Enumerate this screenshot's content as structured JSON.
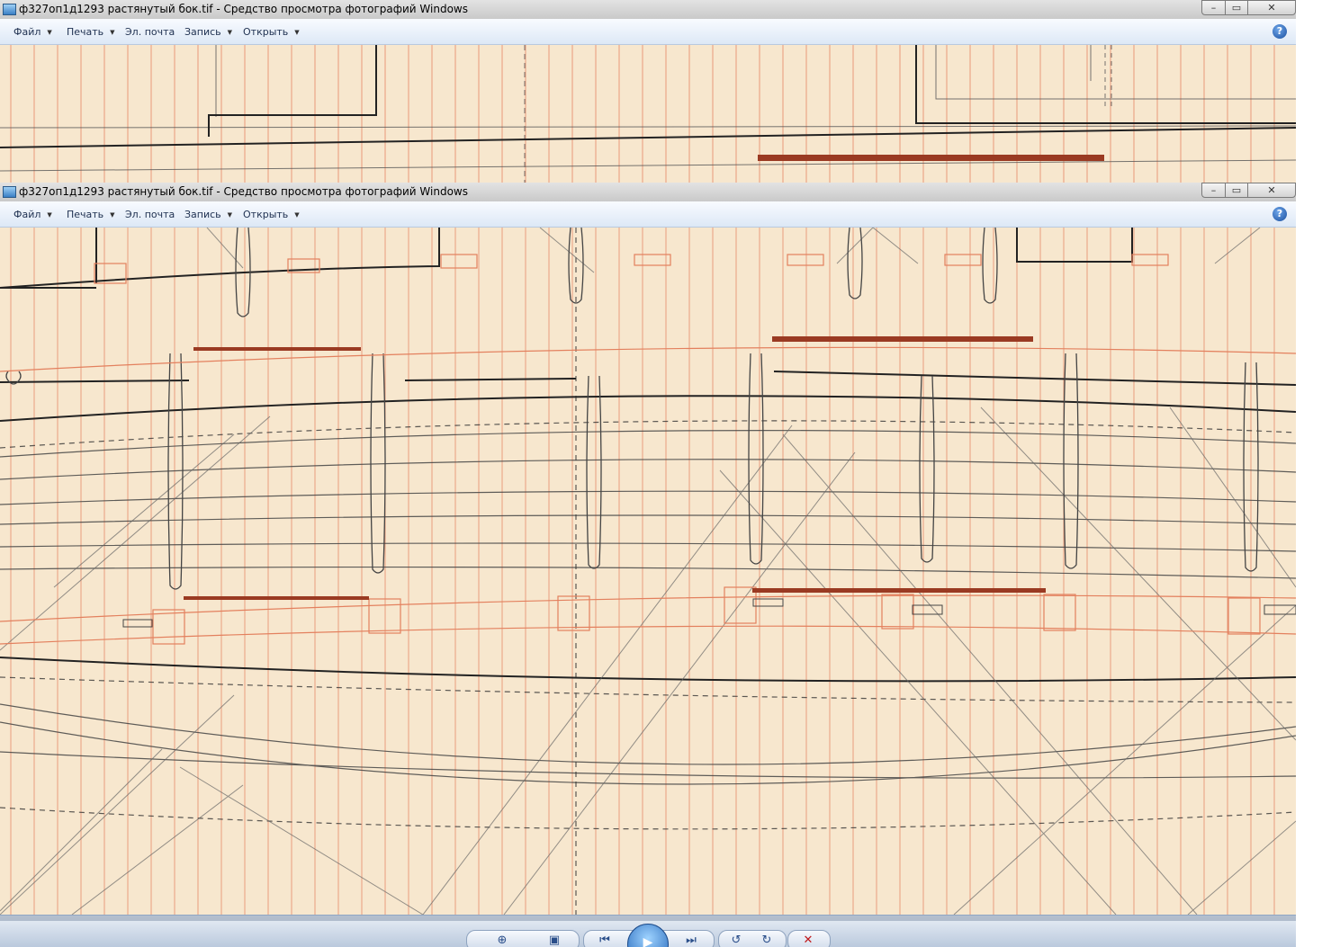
{
  "window_title": "ф327оп1д1293 растянутый бок.tif - Средство просмотра фотографий Windows",
  "menu": {
    "file": "Файл",
    "print": "Печать",
    "email": "Эл. почта",
    "burn": "Запись",
    "open": "Открыть",
    "help": "?"
  },
  "window_buttons": {
    "minimize": "–",
    "maximize": "▭",
    "close": "✕"
  },
  "controls": {
    "zoom": "⊕",
    "actual_size": "▣",
    "previous": "⏮",
    "slideshow": "▶",
    "next": "⏭",
    "rotate_left": "↺",
    "rotate_right": "↻",
    "delete": "✕"
  },
  "colors": {
    "paper": "#f7e7ce",
    "red_grid": "#e3805e",
    "pencil": "#555555",
    "ink": "#222222",
    "red_bar": "#9a3a22",
    "delete_red": "#c0181b"
  },
  "icons": {
    "app": "photo-viewer-icon",
    "help": "help-icon",
    "zoom": "magnifier-icon",
    "actual_size": "fit-window-icon",
    "previous": "previous-icon",
    "slideshow": "play-icon",
    "next": "next-icon",
    "rotate_left": "rotate-left-icon",
    "rotate_right": "rotate-right-icon",
    "delete": "delete-icon"
  }
}
